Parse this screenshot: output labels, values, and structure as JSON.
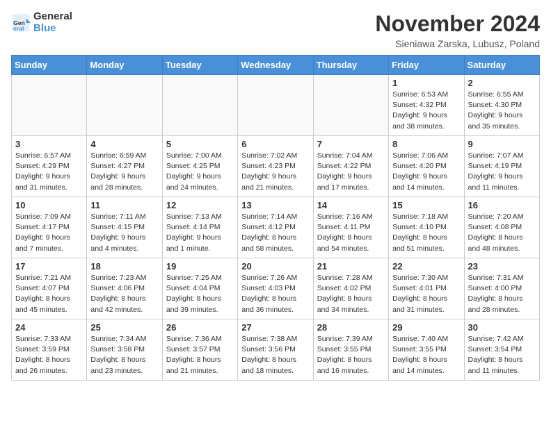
{
  "header": {
    "logo_line1": "General",
    "logo_line2": "Blue",
    "month_title": "November 2024",
    "location": "Sieniawa Zarska, Lubusz, Poland"
  },
  "days_of_week": [
    "Sunday",
    "Monday",
    "Tuesday",
    "Wednesday",
    "Thursday",
    "Friday",
    "Saturday"
  ],
  "weeks": [
    [
      {
        "day": "",
        "info": ""
      },
      {
        "day": "",
        "info": ""
      },
      {
        "day": "",
        "info": ""
      },
      {
        "day": "",
        "info": ""
      },
      {
        "day": "",
        "info": ""
      },
      {
        "day": "1",
        "info": "Sunrise: 6:53 AM\nSunset: 4:32 PM\nDaylight: 9 hours\nand 38 minutes."
      },
      {
        "day": "2",
        "info": "Sunrise: 6:55 AM\nSunset: 4:30 PM\nDaylight: 9 hours\nand 35 minutes."
      }
    ],
    [
      {
        "day": "3",
        "info": "Sunrise: 6:57 AM\nSunset: 4:29 PM\nDaylight: 9 hours\nand 31 minutes."
      },
      {
        "day": "4",
        "info": "Sunrise: 6:59 AM\nSunset: 4:27 PM\nDaylight: 9 hours\nand 28 minutes."
      },
      {
        "day": "5",
        "info": "Sunrise: 7:00 AM\nSunset: 4:25 PM\nDaylight: 9 hours\nand 24 minutes."
      },
      {
        "day": "6",
        "info": "Sunrise: 7:02 AM\nSunset: 4:23 PM\nDaylight: 9 hours\nand 21 minutes."
      },
      {
        "day": "7",
        "info": "Sunrise: 7:04 AM\nSunset: 4:22 PM\nDaylight: 9 hours\nand 17 minutes."
      },
      {
        "day": "8",
        "info": "Sunrise: 7:06 AM\nSunset: 4:20 PM\nDaylight: 9 hours\nand 14 minutes."
      },
      {
        "day": "9",
        "info": "Sunrise: 7:07 AM\nSunset: 4:19 PM\nDaylight: 9 hours\nand 11 minutes."
      }
    ],
    [
      {
        "day": "10",
        "info": "Sunrise: 7:09 AM\nSunset: 4:17 PM\nDaylight: 9 hours\nand 7 minutes."
      },
      {
        "day": "11",
        "info": "Sunrise: 7:11 AM\nSunset: 4:15 PM\nDaylight: 9 hours\nand 4 minutes."
      },
      {
        "day": "12",
        "info": "Sunrise: 7:13 AM\nSunset: 4:14 PM\nDaylight: 9 hours\nand 1 minute."
      },
      {
        "day": "13",
        "info": "Sunrise: 7:14 AM\nSunset: 4:12 PM\nDaylight: 8 hours\nand 58 minutes."
      },
      {
        "day": "14",
        "info": "Sunrise: 7:16 AM\nSunset: 4:11 PM\nDaylight: 8 hours\nand 54 minutes."
      },
      {
        "day": "15",
        "info": "Sunrise: 7:18 AM\nSunset: 4:10 PM\nDaylight: 8 hours\nand 51 minutes."
      },
      {
        "day": "16",
        "info": "Sunrise: 7:20 AM\nSunset: 4:08 PM\nDaylight: 8 hours\nand 48 minutes."
      }
    ],
    [
      {
        "day": "17",
        "info": "Sunrise: 7:21 AM\nSunset: 4:07 PM\nDaylight: 8 hours\nand 45 minutes."
      },
      {
        "day": "18",
        "info": "Sunrise: 7:23 AM\nSunset: 4:06 PM\nDaylight: 8 hours\nand 42 minutes."
      },
      {
        "day": "19",
        "info": "Sunrise: 7:25 AM\nSunset: 4:04 PM\nDaylight: 8 hours\nand 39 minutes."
      },
      {
        "day": "20",
        "info": "Sunrise: 7:26 AM\nSunset: 4:03 PM\nDaylight: 8 hours\nand 36 minutes."
      },
      {
        "day": "21",
        "info": "Sunrise: 7:28 AM\nSunset: 4:02 PM\nDaylight: 8 hours\nand 34 minutes."
      },
      {
        "day": "22",
        "info": "Sunrise: 7:30 AM\nSunset: 4:01 PM\nDaylight: 8 hours\nand 31 minutes."
      },
      {
        "day": "23",
        "info": "Sunrise: 7:31 AM\nSunset: 4:00 PM\nDaylight: 8 hours\nand 28 minutes."
      }
    ],
    [
      {
        "day": "24",
        "info": "Sunrise: 7:33 AM\nSunset: 3:59 PM\nDaylight: 8 hours\nand 26 minutes."
      },
      {
        "day": "25",
        "info": "Sunrise: 7:34 AM\nSunset: 3:58 PM\nDaylight: 8 hours\nand 23 minutes."
      },
      {
        "day": "26",
        "info": "Sunrise: 7:36 AM\nSunset: 3:57 PM\nDaylight: 8 hours\nand 21 minutes."
      },
      {
        "day": "27",
        "info": "Sunrise: 7:38 AM\nSunset: 3:56 PM\nDaylight: 8 hours\nand 18 minutes."
      },
      {
        "day": "28",
        "info": "Sunrise: 7:39 AM\nSunset: 3:55 PM\nDaylight: 8 hours\nand 16 minutes."
      },
      {
        "day": "29",
        "info": "Sunrise: 7:40 AM\nSunset: 3:55 PM\nDaylight: 8 hours\nand 14 minutes."
      },
      {
        "day": "30",
        "info": "Sunrise: 7:42 AM\nSunset: 3:54 PM\nDaylight: 8 hours\nand 11 minutes."
      }
    ]
  ]
}
